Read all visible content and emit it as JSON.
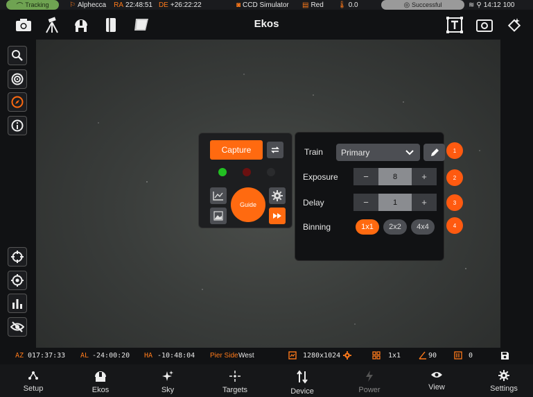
{
  "status": {
    "tracking": "Tracking",
    "target": "Alphecca",
    "ra_label": "RA",
    "ra_value": "22:48:51",
    "de_label": "DE",
    "de_value": "+26:22:22",
    "camera": "CCD Simulator",
    "filter": "Red",
    "temperature": "0.0",
    "connection": "Successful",
    "clock": "14:12",
    "battery": "100"
  },
  "topbar": {
    "title": "Ekos"
  },
  "widget": {
    "capture_label": "Capture",
    "guide_label": "Guide",
    "dots": [
      "#22c022",
      "#6a1010",
      "#2a2b2d"
    ]
  },
  "panel": {
    "train_label": "Train",
    "train_value": "Primary",
    "exposure_label": "Exposure",
    "exposure_value": "8",
    "delay_label": "Delay",
    "delay_value": "1",
    "binning_label": "Binning",
    "binning_options": [
      "1x1",
      "2x2",
      "4x4"
    ],
    "binning_selected": "1x1",
    "minus": "−",
    "plus": "+",
    "badges": [
      "1",
      "2",
      "3",
      "4"
    ]
  },
  "infobar": {
    "az_label": "AZ",
    "az_value": "017:37:33",
    "al_label": "AL",
    "al_value": "-24:00:20",
    "ha_label": "HA",
    "ha_value": "-10:48:04",
    "pier_label": "Pier Side",
    "pier_value": "West",
    "resolution": "1280x1024",
    "binning": "1x1",
    "rotation": "90",
    "count": "0"
  },
  "nav": {
    "items": [
      "Setup",
      "Ekos",
      "Sky",
      "Targets",
      "Device",
      "Power",
      "View",
      "Settings"
    ]
  },
  "colors": {
    "accent": "#ff6a10",
    "tracking": "#6fa352"
  }
}
